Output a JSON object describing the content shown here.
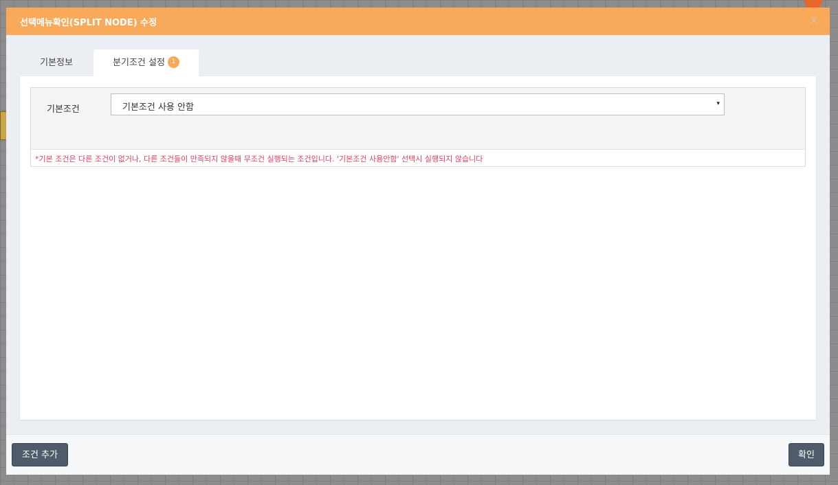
{
  "modal": {
    "title": "선택메뉴확인(SPLIT NODE) 수정",
    "close_label": "X"
  },
  "tabs": [
    {
      "label": "기본정보"
    },
    {
      "label": "분기조건 설정",
      "badge": "1"
    }
  ],
  "condition": {
    "label": "기본조건",
    "selected_value": "기본조건 사용 안함",
    "caret": "▾",
    "note": "*기본 조건은 다른 조건이 없거나, 다른 조건들이 만족되지 않을때 무조건 실행되는 조건입니다. '기본조건 사용안함' 선택시 실행되지 않습니다"
  },
  "footer": {
    "add_condition_label": "조건 추가",
    "confirm_label": "확인"
  },
  "colors": {
    "header": "#f9a95a",
    "note": "#e0405a",
    "button": "#4e5b6b"
  }
}
